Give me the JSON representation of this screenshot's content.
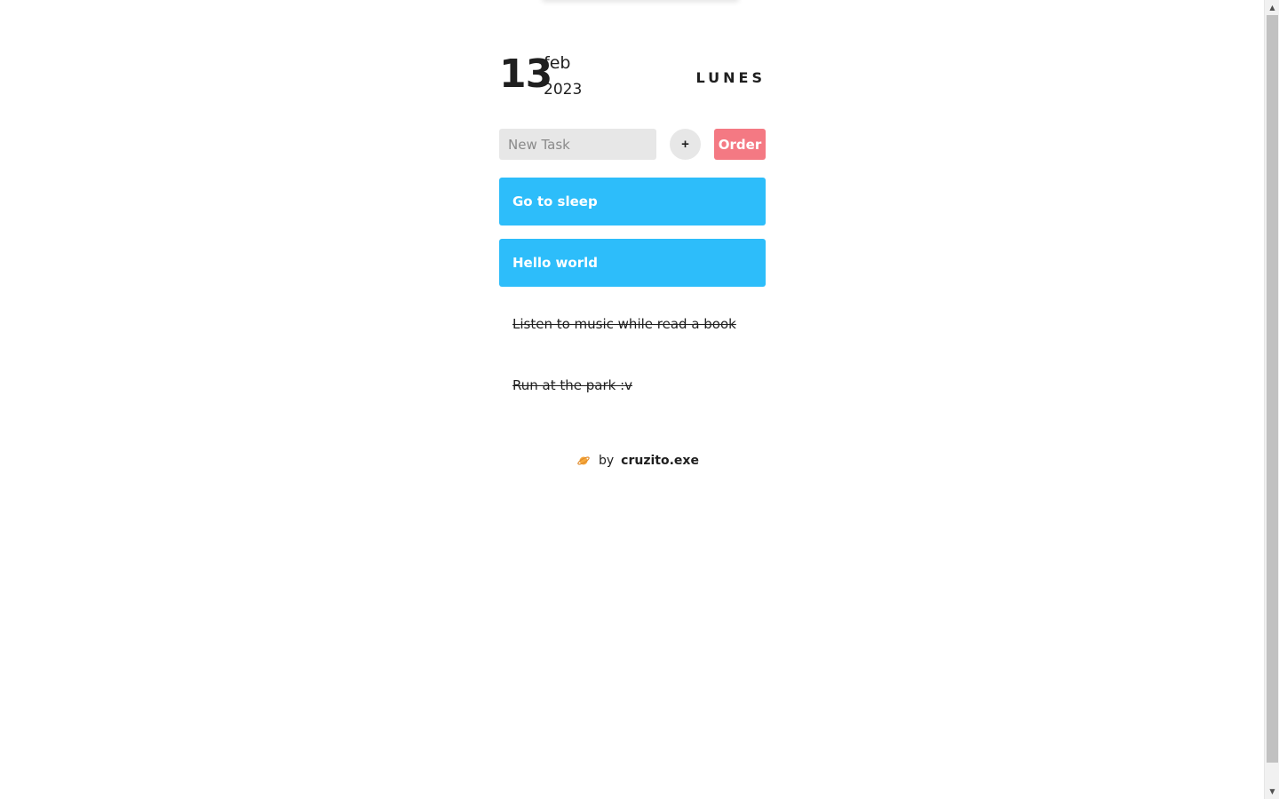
{
  "date": {
    "day": "13",
    "month": "feb",
    "year": "2023",
    "weekday": "LUNES"
  },
  "new_task": {
    "placeholder": "New Task",
    "value": "",
    "add_label": "+",
    "order_label": "Order"
  },
  "tasks": [
    {
      "label": "Go to sleep",
      "done": false
    },
    {
      "label": "Hello world",
      "done": false
    },
    {
      "label": "Listen to music while read a book",
      "done": true
    },
    {
      "label": "Run at the park :v",
      "done": true
    }
  ],
  "footer": {
    "icon": "planet-icon",
    "by": "by",
    "author": "cruzito.exe"
  },
  "colors": {
    "active_task": "#2dbdfa",
    "order_button": "#f47983",
    "input_bg": "#e7e7e7"
  }
}
